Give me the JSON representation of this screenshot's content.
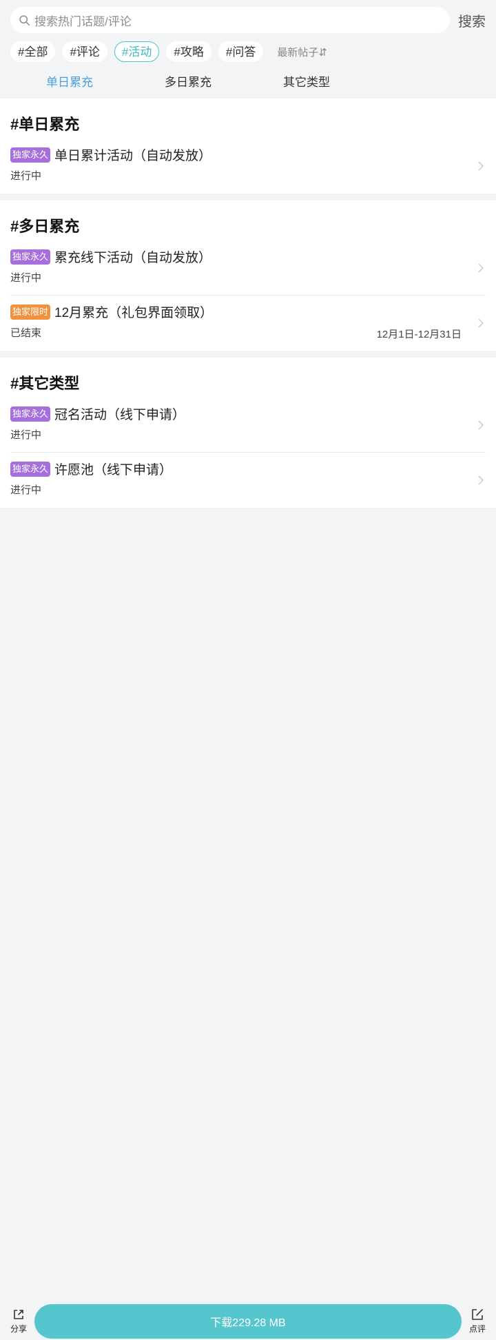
{
  "search": {
    "placeholder": "搜索热门话题/评论",
    "button_label": "搜索"
  },
  "tags": [
    {
      "label": "#全部"
    },
    {
      "label": "#评论"
    },
    {
      "label": "#活动"
    },
    {
      "label": "#攻略"
    },
    {
      "label": "#问答"
    }
  ],
  "sort_label": "最新帖子⇵",
  "subtabs": [
    {
      "label": "单日累充"
    },
    {
      "label": "多日累充"
    },
    {
      "label": "其它类型"
    }
  ],
  "sections": [
    {
      "title": "#单日累充",
      "items": [
        {
          "badge": "独家永久",
          "title": "单日累计活动（自动发放）",
          "status": "进行中"
        }
      ]
    },
    {
      "title": "#多日累充",
      "items": [
        {
          "badge": "独家永久",
          "title": "累充线下活动（自动发放）",
          "status": "进行中"
        },
        {
          "badge": "独家限时",
          "title": "12月累充（礼包界面领取）",
          "status": "已结束",
          "date": "12月1日-12月31日"
        }
      ]
    },
    {
      "title": "#其它类型",
      "items": [
        {
          "badge": "独家永久",
          "title": "冠名活动（线下申请）",
          "status": "进行中"
        },
        {
          "badge": "独家永久",
          "title": "许愿池（线下申请）",
          "status": "进行中"
        }
      ]
    }
  ],
  "bottom": {
    "share_label": "分享",
    "download_label": "下载229.28 MB",
    "review_label": "点评"
  },
  "colors": {
    "accent": "#55c6ce",
    "active_tag": "#3fb9c3",
    "active_subtab": "#4a9fdc",
    "badge_permanent": "#a76fdc",
    "badge_limited": "#f0913d"
  }
}
